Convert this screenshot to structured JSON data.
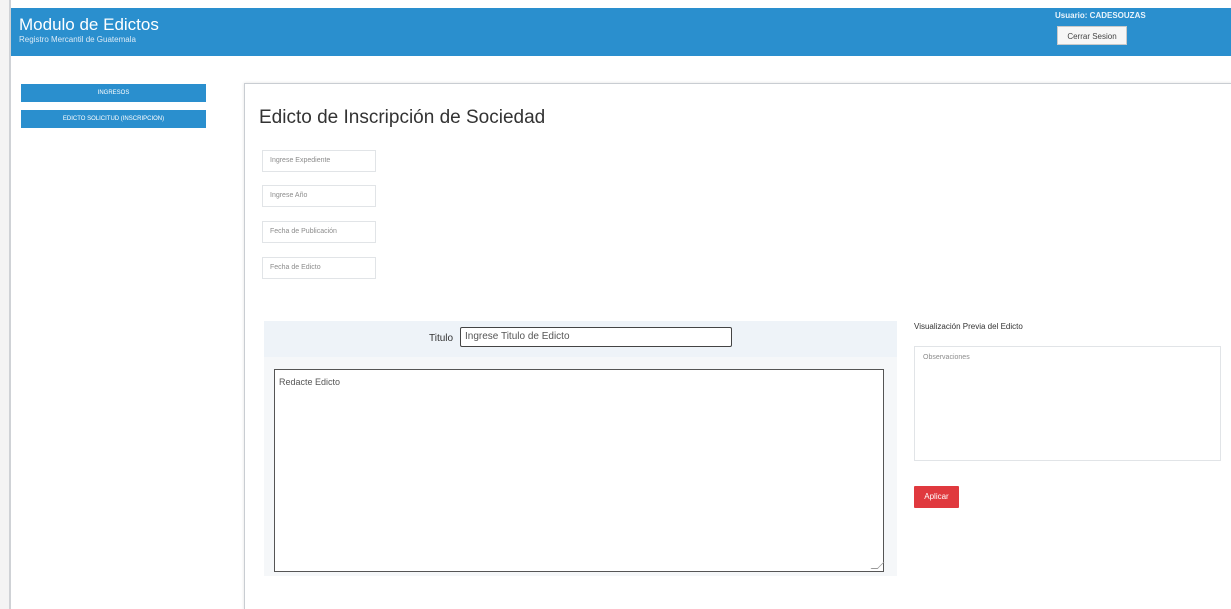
{
  "header": {
    "title": "Modulo de Edictos",
    "subtitle": "Registro Mercantil de Guatemala",
    "user_label": "Usuario: CADESOUZAS",
    "logout_label": "Cerrar Sesion"
  },
  "sidebar": {
    "items": [
      {
        "label": "INGRESOS"
      },
      {
        "label": "EDICTO SOLICITUD (INSCRIPCION)"
      }
    ]
  },
  "main": {
    "title": "Edicto de Inscripción de Sociedad",
    "fields": {
      "expediente_placeholder": "Ingrese Expediente",
      "anio_placeholder": "Ingrese Año",
      "fecha_publicacion_placeholder": "Fecha de Publicación",
      "fecha_edicto_placeholder": "Fecha de Edicto"
    },
    "editor": {
      "title_label": "Titulo",
      "title_placeholder": "Ingrese Titulo de Edicto",
      "body_placeholder": "Redacte Edicto"
    },
    "preview": {
      "label": "Visualización Previa del Edicto",
      "observations_placeholder": "Observaciones",
      "apply_label": "Aplicar"
    }
  },
  "colors": {
    "brand": "#2a8fce",
    "danger": "#e0393e"
  }
}
